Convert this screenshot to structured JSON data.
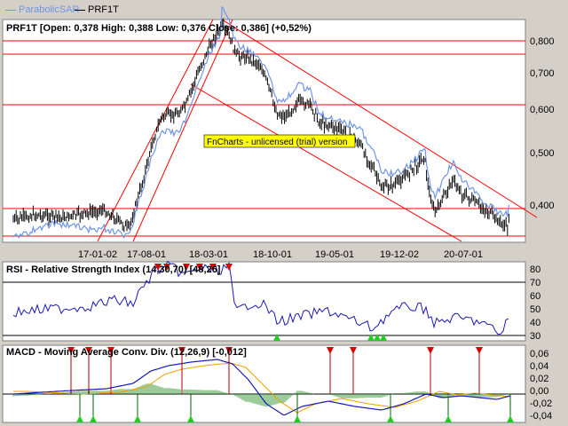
{
  "legend": [
    {
      "label": "ParabolicSAR",
      "color": "#6f95e6"
    },
    {
      "label": "PRF1T",
      "color": "#000000"
    }
  ],
  "price_panel": {
    "title": "PRF1T [Open: 0,378  High: 0,388  Low: 0,376  Close: 0,386] (+0,52%)",
    "watermark": "FnCharts - unlicensed (trial) version",
    "y_ticks": [
      "0,800",
      "0,700",
      "0,600",
      "0,500",
      "0,400"
    ],
    "x_ticks": [
      "17-01-02",
      "17-08-01",
      "18-03-01",
      "18-10-01",
      "19-05-01",
      "19-12-02",
      "20-07-01"
    ]
  },
  "rsi_panel": {
    "title": "RSI - Relative Strength Index (14,30,70) [48,26]",
    "y_ticks": [
      "80",
      "70",
      "60",
      "50",
      "40",
      "30"
    ]
  },
  "macd_panel": {
    "title": "MACD - Moving Average Conv. Div. (12,26,9) [-0,012]",
    "y_ticks": [
      "0,06",
      "0,04",
      "0,02",
      "0,00",
      "-0,02",
      "-0,04"
    ]
  },
  "colors": {
    "price": "#000000",
    "sar": "#6f95e6",
    "trendline": "#ff0000",
    "rsi_line": "#1a1ab4",
    "macd_line": "#1a1ab4",
    "signal_line": "#f0a000",
    "histogram": "#3a9a3a",
    "buy_marker": "#22cc22",
    "sell_marker": "#dd0000"
  }
}
